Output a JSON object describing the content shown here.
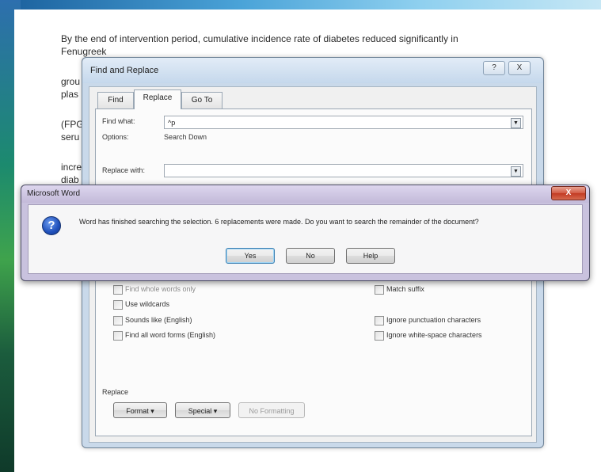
{
  "document": {
    "lines": [
      "By the end of intervention period, cumulative incidence rate of diabetes reduced significantly in",
      "Fenugreek",
      "grou",
      "plas",
      "(FPG",
      "seru",
      "incre",
      "diab"
    ]
  },
  "find_replace": {
    "title": "Find and Replace",
    "help_btn": "?",
    "close_btn": "X",
    "tabs": [
      "Find",
      "Replace",
      "Go To"
    ],
    "find_label": "Find what:",
    "find_value": "^p",
    "options_label": "Options:",
    "options_value": "Search Down",
    "replace_label": "Replace with:",
    "replace_value": "",
    "checkboxes_left": [
      "Find whole words only",
      "Use wildcards",
      "Sounds like (English)",
      "Find all word forms (English)"
    ],
    "checkboxes_right": [
      "Match suffix",
      "Ignore punctuation characters",
      "Ignore white-space characters"
    ],
    "replace_section_label": "Replace",
    "format_btn": "Format ▾",
    "special_btn": "Special ▾",
    "no_formatting_btn": "No Formatting"
  },
  "message_box": {
    "title": "Microsoft Word",
    "close": "X",
    "icon": "question-icon",
    "icon_glyph": "?",
    "message": "Word has finished searching the selection.  6 replacements were made.  Do you want to search the remainder of the document?",
    "buttons": [
      "Yes",
      "No",
      "Help"
    ]
  }
}
